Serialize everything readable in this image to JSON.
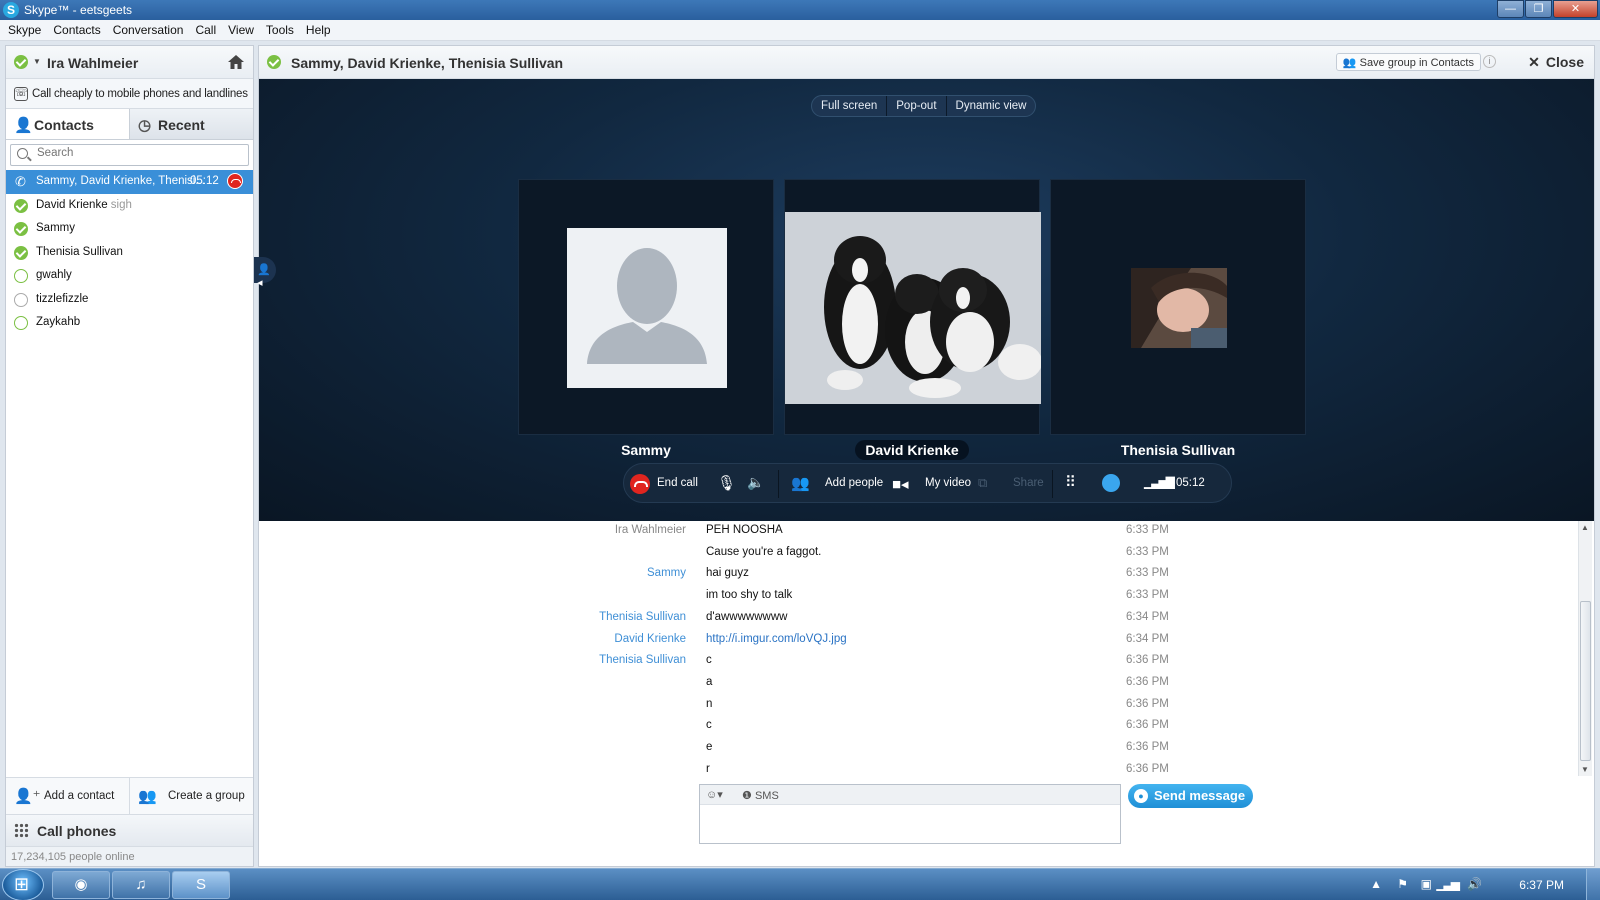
{
  "window": {
    "title": "Skype™ - eetsgeets",
    "app_icon": "S",
    "minimize": "—",
    "maximize": "❐",
    "close": "✕"
  },
  "menu": [
    "Skype",
    "Contacts",
    "Conversation",
    "Call",
    "View",
    "Tools",
    "Help"
  ],
  "sidebar": {
    "user_name": "Ira Wahlmeier",
    "promo": "Call cheaply to mobile phones and landlines",
    "tabs": {
      "contacts": "Contacts",
      "recent": "Recent"
    },
    "search_placeholder": "Search",
    "active_call": {
      "label": "Sammy, David Krienke, Thenisi...",
      "duration": "05:12"
    },
    "contacts": [
      {
        "name": "David Krienke",
        "mood": "sigh",
        "status": "online"
      },
      {
        "name": "Sammy",
        "mood": "",
        "status": "online"
      },
      {
        "name": "Thenisia Sullivan",
        "mood": "",
        "status": "online"
      },
      {
        "name": "gwahly",
        "mood": "",
        "status": "offline"
      },
      {
        "name": "tizzlefizzle",
        "mood": "",
        "status": "away"
      },
      {
        "name": "Zaykahb",
        "mood": "",
        "status": "offline"
      }
    ],
    "add_contact": "Add a contact",
    "create_group": "Create a group",
    "call_phones": "Call phones",
    "online_count": "17,234,105 people online"
  },
  "conversation": {
    "title": "Sammy, David Krienke, Thenisia Sullivan",
    "save_group": "Save group in Contacts",
    "info": "i",
    "close": "Close",
    "view_modes": [
      "Full screen",
      "Pop-out",
      "Dynamic view"
    ],
    "participants": [
      {
        "name": "Sammy",
        "avatar": "default-avatar"
      },
      {
        "name": "David Krienke",
        "avatar": "puppies-photo"
      },
      {
        "name": "Thenisia Sullivan",
        "avatar": "profile-photo"
      }
    ],
    "callbar": {
      "end_call": "End call",
      "add_people": "Add people",
      "my_video": "My video",
      "share": "Share",
      "duration": "05:12"
    },
    "messages": [
      {
        "sender": "Ira Wahlmeier",
        "sender_color": "gray",
        "text": "PEH NOOSHA",
        "time": "6:33 PM"
      },
      {
        "sender": "",
        "text": "Cause you're a faggot.",
        "time": "6:33 PM"
      },
      {
        "sender": "Sammy",
        "sender_color": "blue",
        "text": "hai guyz",
        "time": "6:33 PM"
      },
      {
        "sender": "",
        "text": "im too shy to talk",
        "time": "6:33 PM"
      },
      {
        "sender": "Thenisia Sullivan",
        "sender_color": "blue",
        "text": "d'awwwwwwww",
        "time": "6:34 PM"
      },
      {
        "sender": "David Krienke",
        "sender_color": "blue",
        "text": "http://i.imgur.com/loVQJ.jpg",
        "link": true,
        "time": "6:34 PM"
      },
      {
        "sender": "Thenisia Sullivan",
        "sender_color": "blue",
        "text": "c",
        "time": "6:36 PM"
      },
      {
        "sender": "",
        "text": "a",
        "time": "6:36 PM"
      },
      {
        "sender": "",
        "text": "n",
        "time": "6:36 PM"
      },
      {
        "sender": "",
        "text": "c",
        "time": "6:36 PM"
      },
      {
        "sender": "",
        "text": "e",
        "time": "6:36 PM"
      },
      {
        "sender": "",
        "text": "r",
        "time": "6:36 PM"
      }
    ],
    "composer": {
      "sms": "SMS",
      "value": ""
    },
    "send_message": "Send message"
  },
  "taskbar": {
    "clock": "6:37 PM",
    "apps": [
      "chrome",
      "itunes",
      "skype"
    ]
  },
  "colors": {
    "skype_blue": "#3a8fd8",
    "online_green": "#7bc043",
    "stage_dark": "#112840",
    "end_call_red": "#e0251f"
  }
}
